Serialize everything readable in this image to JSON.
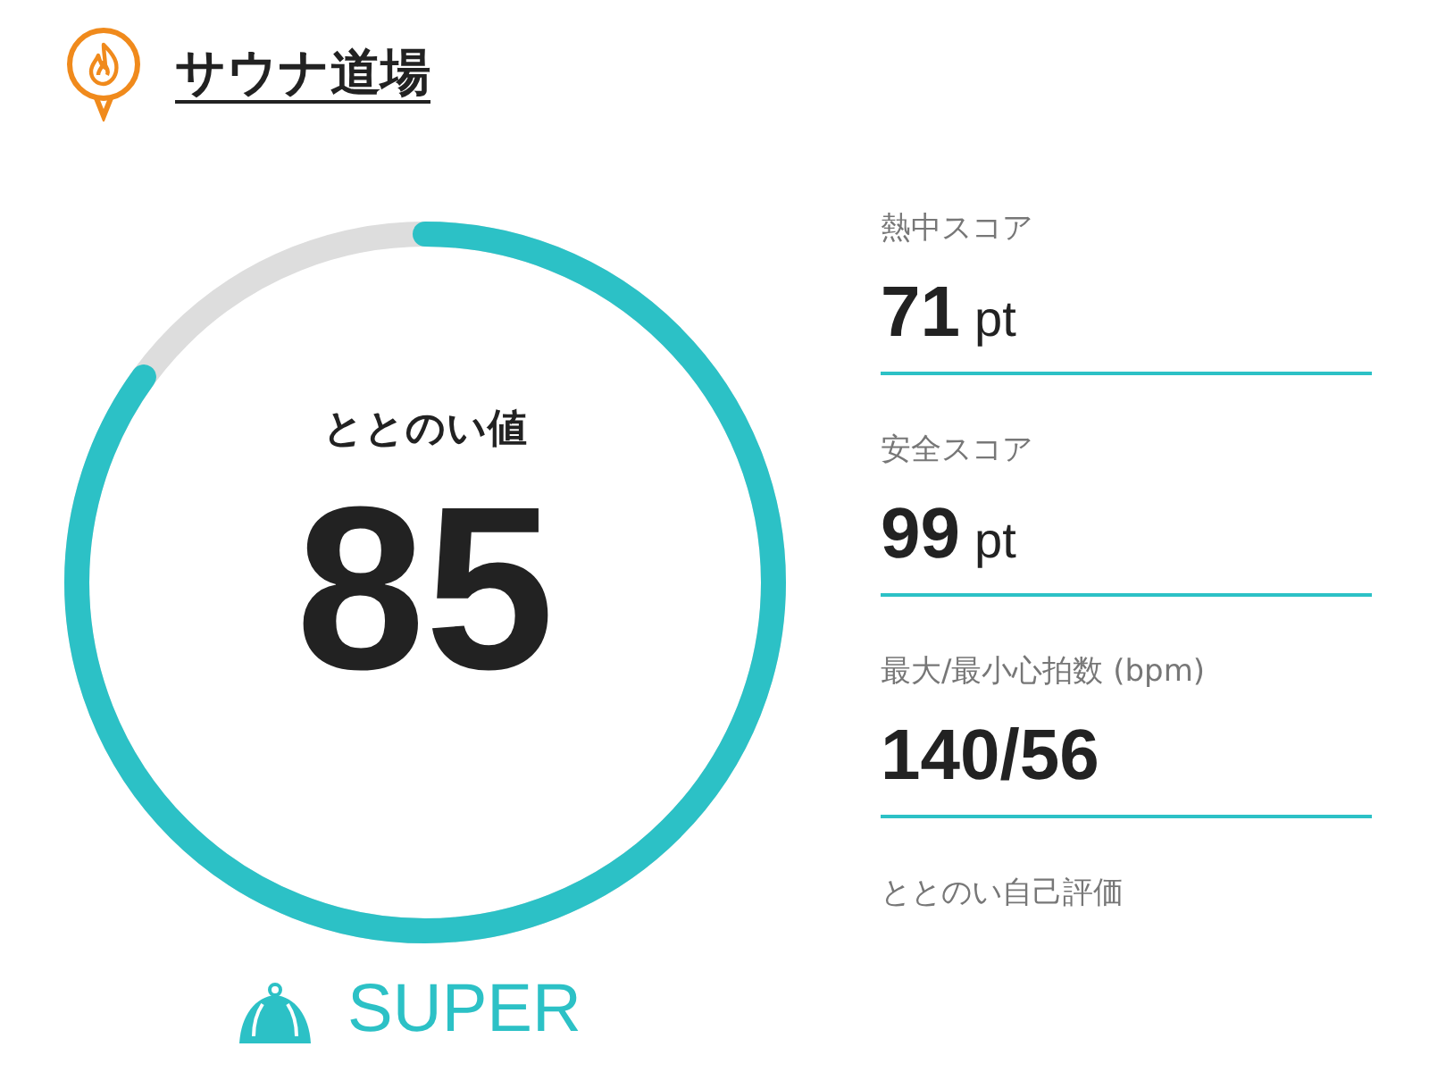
{
  "header": {
    "title": "サウナ道場"
  },
  "score": {
    "label": "ととのい値",
    "value": "85",
    "level": 0.85
  },
  "rating": {
    "text": "SUPER"
  },
  "metrics": [
    {
      "label": "熱中スコア",
      "value": "71",
      "unit": "pt"
    },
    {
      "label": "安全スコア",
      "value": "99",
      "unit": "pt"
    },
    {
      "label": "最大/最小心拍数 (bpm)",
      "value": "140/56"
    }
  ],
  "self_rating": {
    "label": "ととのい自己評価"
  }
}
